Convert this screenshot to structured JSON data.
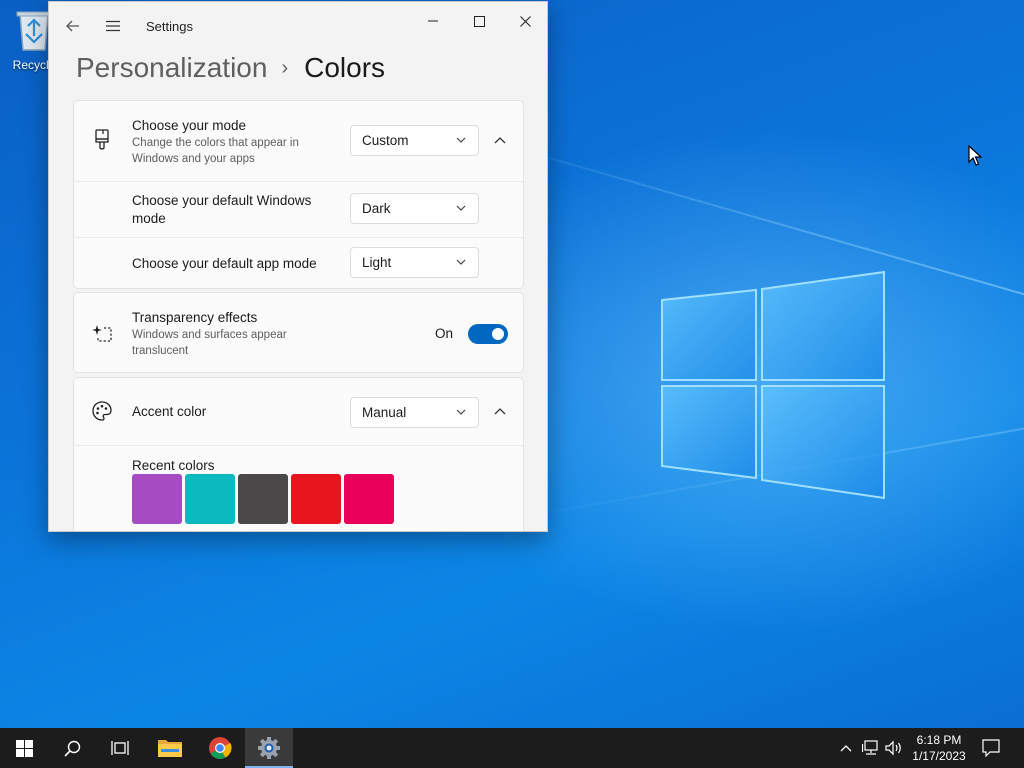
{
  "desktop": {
    "recycle_bin_label": "Recycle"
  },
  "window": {
    "app_title": "Settings",
    "breadcrumb": {
      "parent": "Personalization",
      "separator": "›",
      "current": "Colors"
    }
  },
  "mode_card": {
    "choose_mode": {
      "title": "Choose your mode",
      "description": "Change the colors that appear in Windows and your apps",
      "selected": "Custom",
      "expanded": true
    },
    "windows_mode": {
      "title": "Choose your default Windows mode",
      "selected": "Dark"
    },
    "app_mode": {
      "title": "Choose your default app mode",
      "selected": "Light"
    }
  },
  "transparency": {
    "title": "Transparency effects",
    "description": "Windows and surfaces appear translucent",
    "state_label": "On",
    "on": true
  },
  "accent": {
    "title": "Accent color",
    "selected": "Manual",
    "expanded": true,
    "recent_colors_label": "Recent colors",
    "recent_colors": [
      "#a64bc2",
      "#0bb9bf",
      "#4a4848",
      "#e8141e",
      "#e8005a"
    ]
  },
  "taskbar": {
    "items": [
      "start-button",
      "search-button",
      "task-view-button",
      "file-explorer-button",
      "chrome-button",
      "settings-button"
    ],
    "active_item": "settings-button",
    "clock": {
      "time": "6:18 PM",
      "date": "1/17/2023"
    }
  },
  "colors": {
    "accent": "#0067c0",
    "window_bg": "#f3f3f3",
    "taskbar_bg": "#1c1c1c",
    "desktop_blue": "#0a78d7"
  }
}
